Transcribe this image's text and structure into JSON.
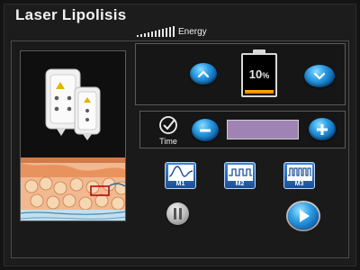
{
  "app": {
    "title": "Laser Lipolisis"
  },
  "energy": {
    "label": "Energy",
    "level_percent": 10,
    "level_text": "10",
    "unit": "%"
  },
  "time": {
    "label": "Time",
    "value": ""
  },
  "modes": [
    {
      "label": "M1"
    },
    {
      "label": "M2"
    },
    {
      "label": "M3"
    }
  ],
  "colors": {
    "background": "#141414",
    "accent_blue": "#2d9ee6",
    "time_display": "#a083b5",
    "battery_fill": "#ff9a00"
  },
  "icons": {
    "energy": "signal-bars-icon",
    "increase": "chevron-up-icon",
    "decrease": "chevron-down-icon",
    "time": "check-circle-icon",
    "minus": "minus-icon",
    "plus": "plus-icon",
    "pause": "pause-icon",
    "play": "play-icon"
  }
}
